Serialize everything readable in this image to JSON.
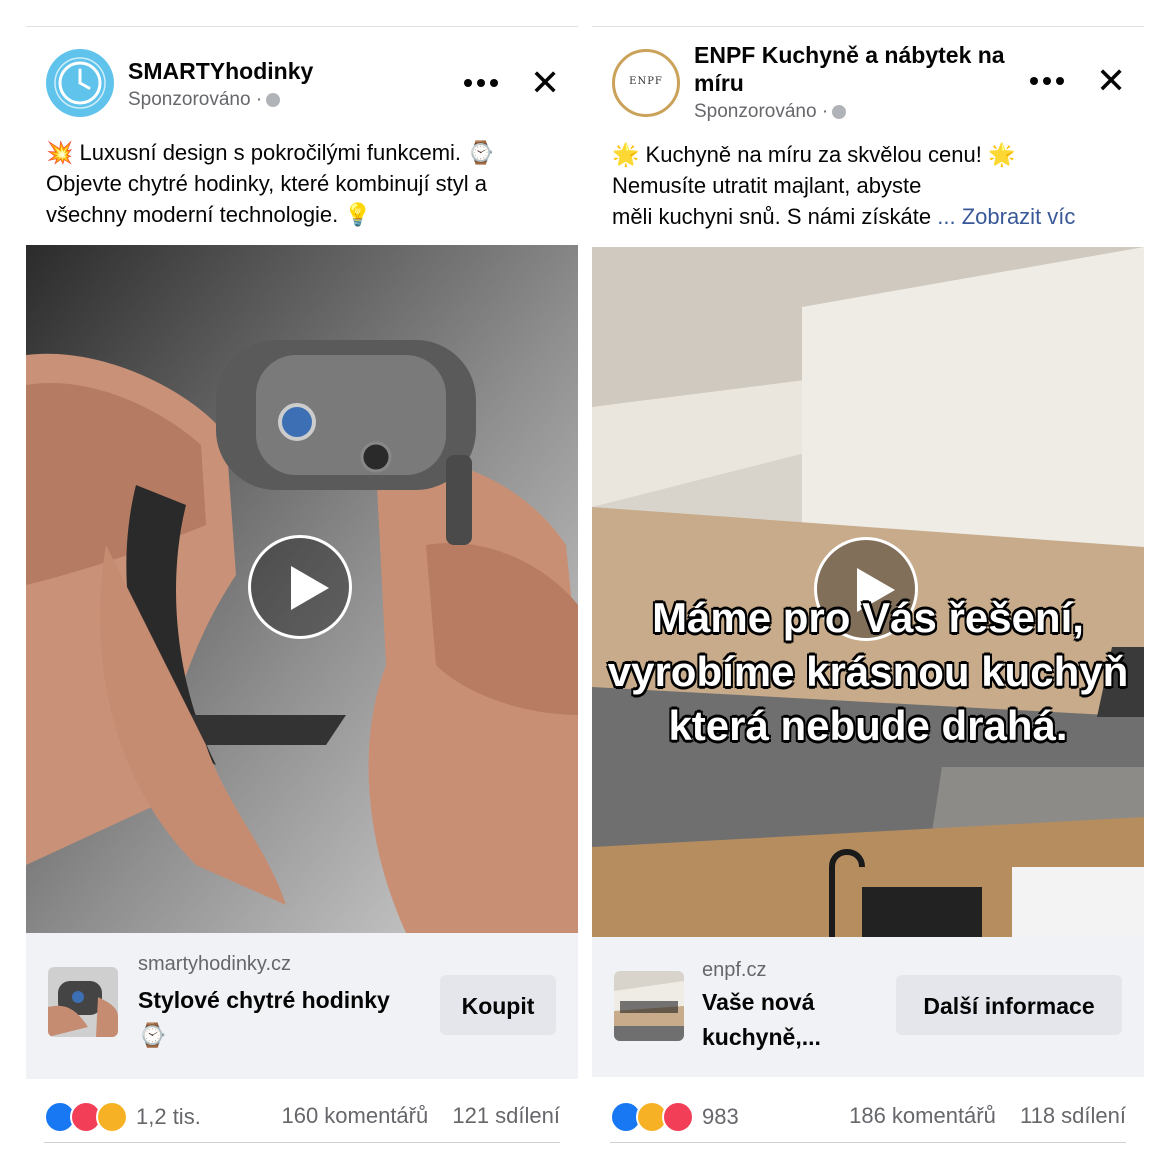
{
  "posts": [
    {
      "page_name": "SMARTYhodinky",
      "sponsored": "Sponzorováno ·",
      "text": {
        "emoji1": "💥",
        "line1": "Luxusní design s pokročilými funkcemi.",
        "emoji2": "⌚",
        "line2": "Objevte chytré hodinky, které kombinují styl a",
        "line3": "všechny moderní technologie.",
        "emoji3": "💡"
      },
      "cta": {
        "domain": "smartyhodinky.cz",
        "title": "Stylové chytré hodinky",
        "title_emoji": "⌚",
        "button": "Koupit"
      },
      "reactions": {
        "count": "1,2 tis.",
        "icons": [
          "like",
          "love",
          "haha"
        ]
      },
      "comments": "160 komentářů",
      "shares": "121 sdílení"
    },
    {
      "page_name": "ENPF Kuchyně a nábytek na míru",
      "avatar_text": "ENPF",
      "sponsored": "Sponzorováno ·",
      "text": {
        "emoji1": "🌟",
        "line1": "Kuchyně na míru za skvělou cenu!",
        "emoji2": "🌟",
        "line2": "Nemusíte utratit majlant, abyste",
        "line3": "měli kuchyni snů. S námi získáte",
        "more": "... Zobrazit víc"
      },
      "video_caption": [
        "Máme pro Vás řešení,",
        "vyrobíme krásnou kuchyň",
        "která nebude drahá."
      ],
      "cta": {
        "domain": "enpf.cz",
        "title": "Vaše nová kuchyně,...",
        "button": "Další informace"
      },
      "reactions": {
        "count": "983",
        "icons": [
          "like",
          "haha",
          "love"
        ]
      },
      "comments": "186 komentářů",
      "shares": "118 sdílení"
    }
  ]
}
